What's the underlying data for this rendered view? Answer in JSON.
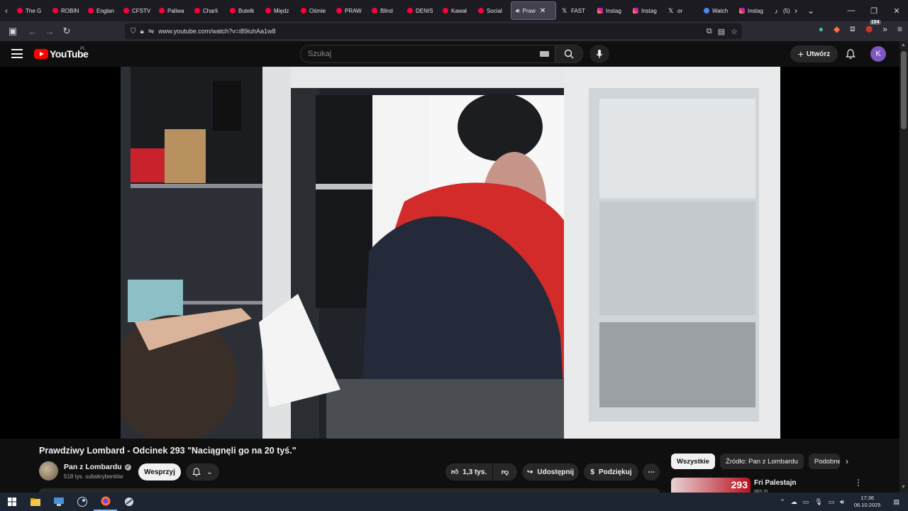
{
  "browser": {
    "tabs": [
      {
        "label": "The G",
        "icon": "youtube-icon"
      },
      {
        "label": "ROBIN",
        "icon": "youtube-icon"
      },
      {
        "label": "Englan",
        "icon": "youtube-icon"
      },
      {
        "label": "CFSTV",
        "icon": "youtube-icon"
      },
      {
        "label": "Paliwa",
        "icon": "youtube-icon"
      },
      {
        "label": "Charli",
        "icon": "youtube-icon"
      },
      {
        "label": "Butelk",
        "icon": "youtube-icon"
      },
      {
        "label": "Międz",
        "icon": "youtube-icon"
      },
      {
        "label": "Ośmie",
        "icon": "youtube-icon"
      },
      {
        "label": "PRAW",
        "icon": "youtube-icon"
      },
      {
        "label": "Blind",
        "icon": "youtube-icon"
      },
      {
        "label": "DENIS",
        "icon": "youtube-icon"
      },
      {
        "label": "Kawał",
        "icon": "youtube-icon"
      },
      {
        "label": "Social",
        "icon": "youtube-icon"
      }
    ],
    "active_tab": {
      "label": "Praw",
      "icon": "speaker-icon"
    },
    "tabs_after": [
      {
        "label": "FAST",
        "icon": "x-icon"
      },
      {
        "label": "Instag",
        "icon": "instagram-icon"
      },
      {
        "label": "Instag",
        "icon": "instagram-icon"
      },
      {
        "label": "or",
        "icon": "x-icon"
      },
      {
        "label": "Watch",
        "icon": "globe-icon"
      },
      {
        "label": "Instag",
        "icon": "instagram-icon"
      },
      {
        "label": "(5)",
        "icon": "tiktok-icon"
      }
    ],
    "url": "www.youtube.com/watch?v=i89iuhAa1w8",
    "extensions_badge": "104"
  },
  "youtube": {
    "logo_text": "YouTube",
    "region": "PL",
    "search_placeholder": "Szukaj",
    "create_label": "Utwórz",
    "avatar_letter": "K"
  },
  "video": {
    "title": "Prawdziwy Lombard - Odcinek 293 \"Naciągnęli go na 20 tyś.\"",
    "channel": "Pan z Lombardu",
    "subscribers": "518 tys. subskrybentów",
    "support_label": "Wesprzyj",
    "likes": "1,3 tys.",
    "share_label": "Udostępnij",
    "thanks_label": "Podziękuj"
  },
  "sidebar": {
    "chips": [
      "Wszystkie",
      "Źródło: Pan z Lombardu",
      "Podobne"
    ],
    "rec_title": "Fri Palestajn",
    "rec_sub": "gtm m",
    "rec_thumb_text": "293"
  },
  "taskbar": {
    "time": "17:36",
    "date": "06.10.2025"
  },
  "colors": {
    "youtube_red": "#ff0000",
    "avatar_purple": "#7e57c2",
    "background": "#0f0f0f"
  }
}
